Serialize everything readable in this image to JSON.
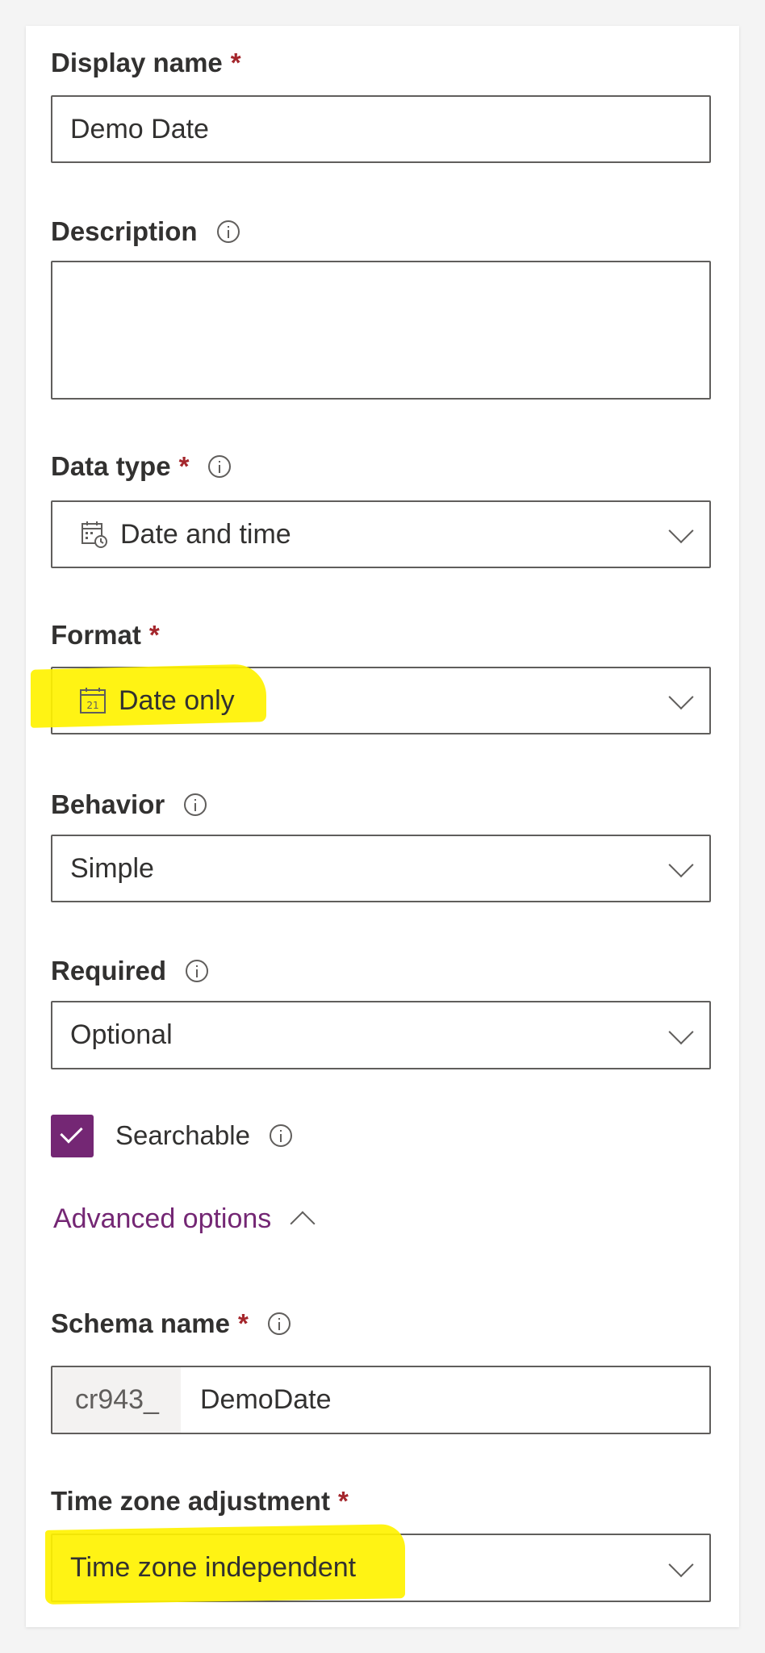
{
  "form": {
    "display_name": {
      "label": "Display name",
      "required_mark": "*",
      "value": "Demo Date"
    },
    "description": {
      "label": "Description",
      "value": ""
    },
    "data_type": {
      "label": "Data type",
      "required_mark": "*",
      "value": "Date and time",
      "icon": "calendar-clock-icon"
    },
    "format": {
      "label": "Format",
      "required_mark": "*",
      "value": "Date only",
      "icon": "calendar-21-icon",
      "icon_text": "21"
    },
    "behavior": {
      "label": "Behavior",
      "value": "Simple"
    },
    "required": {
      "label": "Required",
      "value": "Optional"
    },
    "searchable": {
      "label": "Searchable",
      "checked": true
    },
    "advanced_options": {
      "label": "Advanced options",
      "expanded": true
    },
    "schema_name": {
      "label": "Schema name",
      "required_mark": "*",
      "prefix": "cr943_",
      "value": "DemoDate"
    },
    "time_zone": {
      "label": "Time zone adjustment",
      "required_mark": "*",
      "value": "Time zone independent"
    }
  },
  "colors": {
    "accent": "#742774",
    "required": "#a4262c",
    "border": "#605e5c",
    "highlight": "#fff200"
  }
}
